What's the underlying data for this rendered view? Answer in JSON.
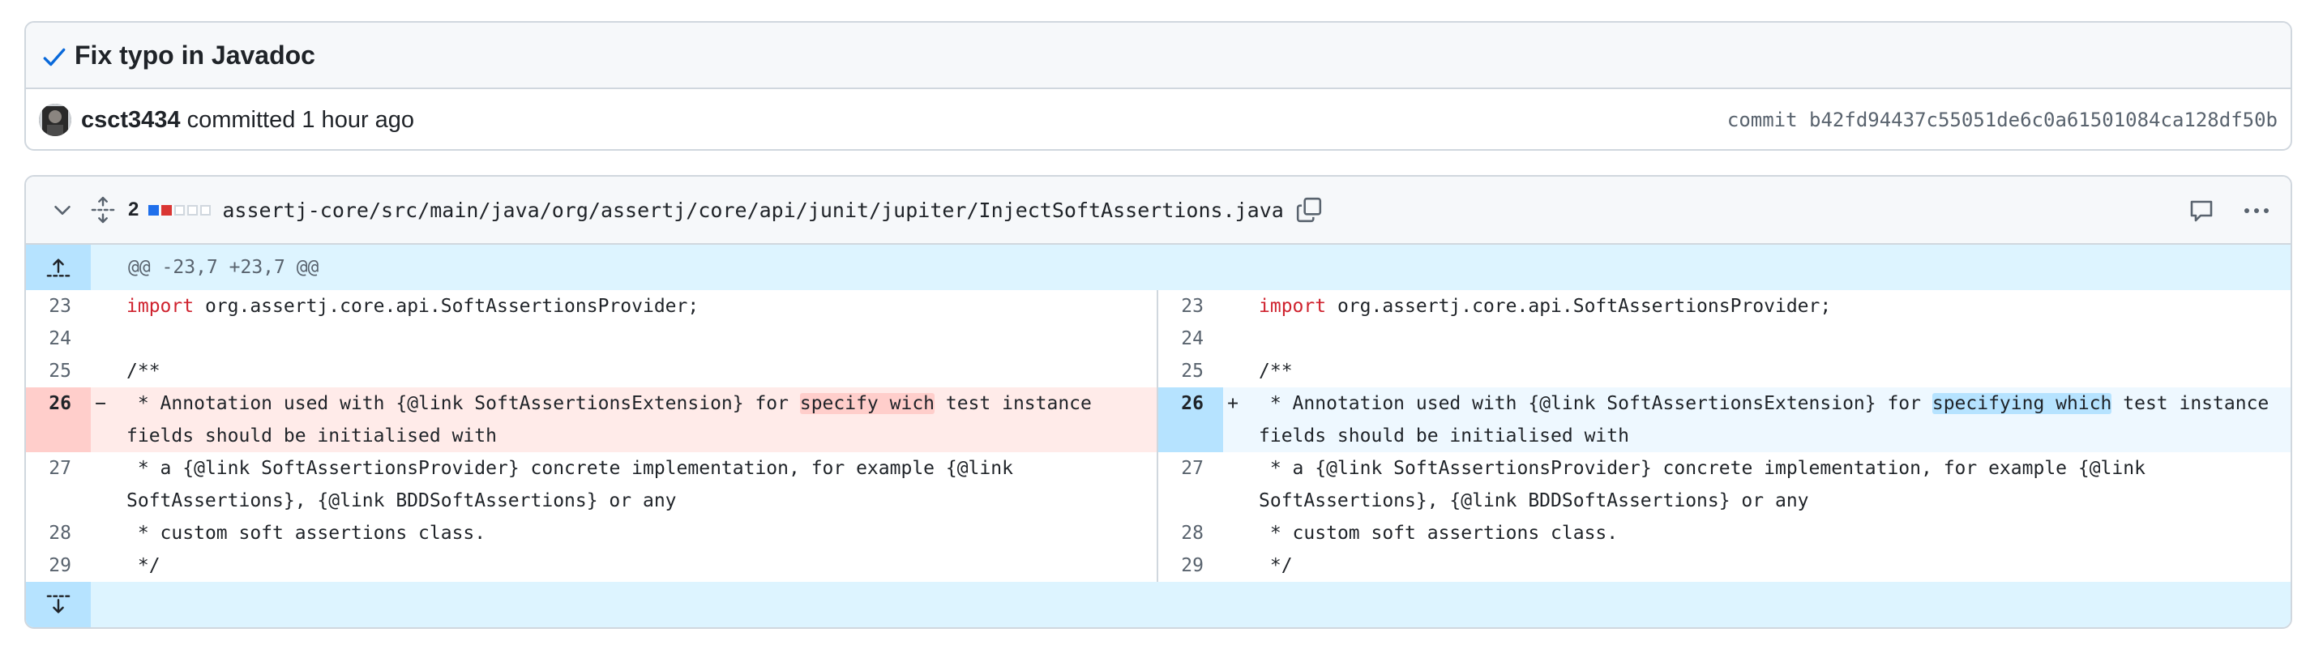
{
  "commit": {
    "title": "Fix typo in Javadoc",
    "author": "csct3434",
    "action_text": "committed 1 hour ago",
    "sha_text": "commit b42fd94437c55051de6c0a61501084ca128df50b"
  },
  "file": {
    "change_count": "2",
    "path": "assertj-core/src/main/java/org/assertj/core/api/junit/jupiter/InjectSoftAssertions.java",
    "diffstat": [
      "add",
      "del",
      "neutral",
      "neutral",
      "neutral"
    ]
  },
  "diff": {
    "hunk_header": "@@ -23,7 +23,7 @@",
    "left": [
      {
        "num": "23",
        "mark": "",
        "pre_kw": "",
        "kw": "import",
        "text": " org.assertj.core.api.SoftAssertionsProvider;",
        "type": "ctx"
      },
      {
        "num": "24",
        "mark": "",
        "kw": "",
        "text": "",
        "type": "ctx"
      },
      {
        "num": "25",
        "mark": "",
        "kw": "",
        "text": "/**",
        "type": "ctx"
      },
      {
        "num": "26",
        "mark": "−",
        "type": "del",
        "before": " * Annotation used with {@link SoftAssertionsExtension} for ",
        "highlight": "specify wich",
        "after": " test instance fields should be initialised with"
      },
      {
        "num": "27",
        "mark": "",
        "kw": "",
        "text": " * a {@link SoftAssertionsProvider} concrete implementation, for example {@link SoftAssertions}, {@link BDDSoftAssertions} or any",
        "type": "ctx"
      },
      {
        "num": "28",
        "mark": "",
        "kw": "",
        "text": " * custom soft assertions class.",
        "type": "ctx"
      },
      {
        "num": "29",
        "mark": "",
        "kw": "",
        "text": " */",
        "type": "ctx"
      }
    ],
    "right": [
      {
        "num": "23",
        "mark": "",
        "kw": "import",
        "text": " org.assertj.core.api.SoftAssertionsProvider;",
        "type": "ctx"
      },
      {
        "num": "24",
        "mark": "",
        "kw": "",
        "text": "",
        "type": "ctx"
      },
      {
        "num": "25",
        "mark": "",
        "kw": "",
        "text": "/**",
        "type": "ctx"
      },
      {
        "num": "26",
        "mark": "+",
        "type": "add",
        "before": " * Annotation used with {@link SoftAssertionsExtension} for ",
        "highlight": "specifying which",
        "after": " test instance fields should be initialised with"
      },
      {
        "num": "27",
        "mark": "",
        "kw": "",
        "text": " * a {@link SoftAssertionsProvider} concrete implementation, for example {@link SoftAssertions}, {@link BDDSoftAssertions} or any",
        "type": "ctx"
      },
      {
        "num": "28",
        "mark": "",
        "kw": "",
        "text": " * custom soft assertions class.",
        "type": "ctx"
      },
      {
        "num": "29",
        "mark": "",
        "kw": "",
        "text": " */",
        "type": "ctx"
      }
    ]
  },
  "colors": {
    "add_accent": "#1f6feb",
    "del_accent": "#da3633",
    "del_bg": "#ffebe9",
    "hunk_bg": "#ddf4ff"
  },
  "icons": {
    "commit_status": "check-icon",
    "collapse": "chevron-down-icon",
    "expand_all": "unfold-icon",
    "copy": "copy-icon",
    "comment": "comment-icon",
    "more": "kebab-horizontal-icon",
    "expand_up": "expand-up-icon",
    "expand_down": "expand-down-icon"
  }
}
